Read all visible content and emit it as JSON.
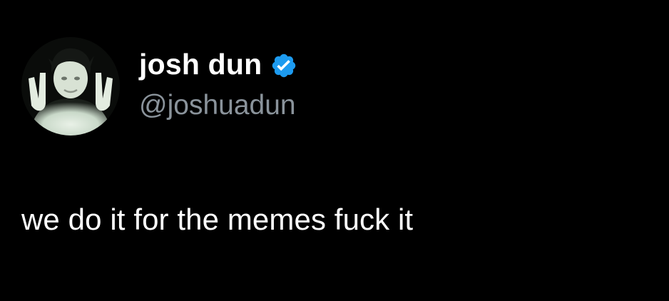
{
  "tweet": {
    "author": {
      "display_name": "josh dun",
      "handle": "@joshuadun",
      "verified_icon": "verified-badge-icon",
      "avatar": "profile-photo"
    },
    "text": "we do it for the memes fuck it"
  },
  "colors": {
    "background": "#000000",
    "text_primary": "#ffffff",
    "text_secondary": "#8a939b",
    "verified_blue": "#1d9bf0"
  }
}
